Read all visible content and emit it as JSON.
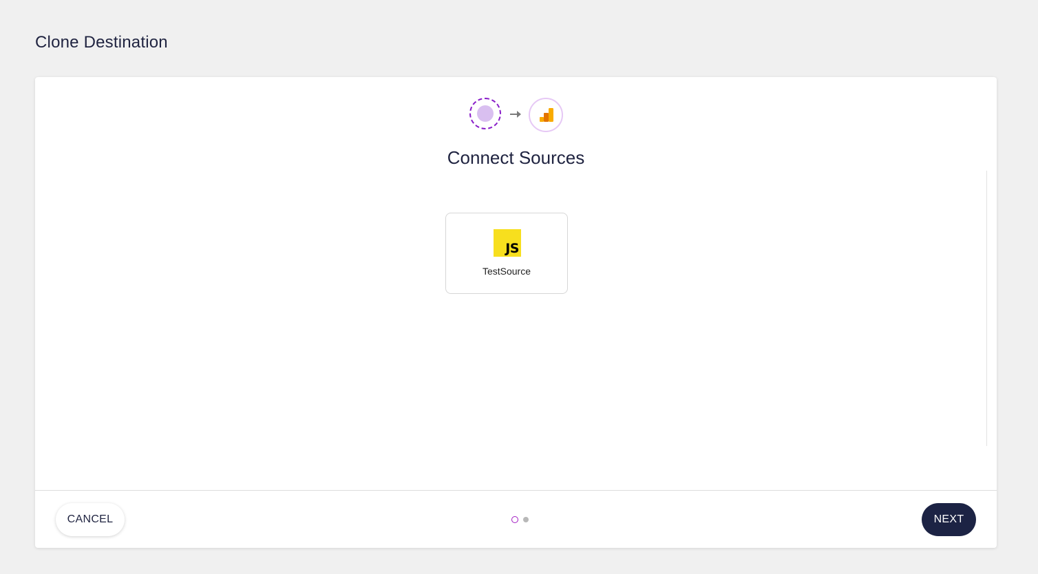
{
  "page": {
    "title": "Clone Destination"
  },
  "wizard": {
    "step_title": "Connect Sources",
    "source_icon": "source-placeholder-icon",
    "arrow_icon": "arrow-right-icon",
    "destination_icon": "google-analytics-icon"
  },
  "sources": [
    {
      "name": "TestSource",
      "icon": "javascript-icon",
      "icon_text": "JS"
    }
  ],
  "footer": {
    "cancel_label": "CANCEL",
    "next_label": "NEXT",
    "pager": {
      "total_steps": 2,
      "current_step": 1
    }
  },
  "colors": {
    "background": "#f0f0f0",
    "card": "#ffffff",
    "primary_dark": "#1c2344",
    "accent_purple": "#8a1fc9",
    "accent_light_purple": "#d9bff0",
    "js_yellow": "#f7df1e",
    "ga_orange": "#f9ab00",
    "ga_dark_orange": "#e37400"
  }
}
